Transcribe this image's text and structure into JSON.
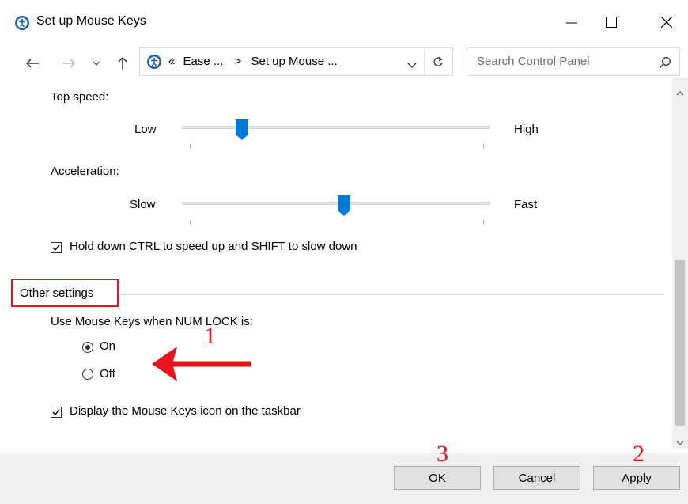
{
  "window": {
    "title": "Set up Mouse Keys",
    "icon": "ease-of-access-icon"
  },
  "address_bar": {
    "prefix": "«",
    "crumb1": "Ease ...",
    "separator": ">",
    "crumb2": "Set up Mouse ...",
    "search_placeholder": "Search Control Panel"
  },
  "top_speed": {
    "label": "Top speed:",
    "min_label": "Low",
    "max_label": "High",
    "level": 0.17
  },
  "acceleration": {
    "label": "Acceleration:",
    "min_label": "Slow",
    "max_label": "Fast",
    "level": 0.5
  },
  "ctrl_shift_option": {
    "label": "Hold down CTRL to speed up and SHIFT to slow down",
    "checked": true
  },
  "other_settings": {
    "title": "Other settings",
    "num_lock_label": "Use Mouse Keys when NUM LOCK is:",
    "on_label": "On",
    "off_label": "Off",
    "selected": "On",
    "taskbar_label": "Display the Mouse Keys icon on the taskbar",
    "taskbar_checked": true
  },
  "buttons": {
    "ok": "OK",
    "cancel": "Cancel",
    "apply": "Apply"
  },
  "annotations": {
    "one": "1",
    "two": "2",
    "three": "3"
  },
  "colors": {
    "accent": "#0078d7",
    "annotation": "#e8141c"
  }
}
